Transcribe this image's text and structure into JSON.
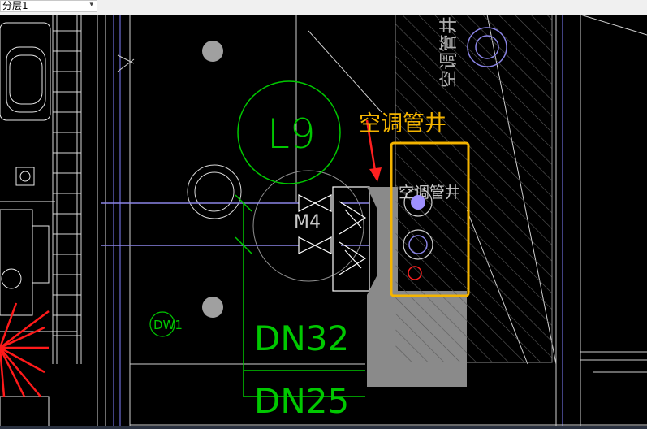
{
  "toolbar": {
    "layer_select": {
      "value": "分层1",
      "icon": "chevron-down-icon"
    }
  },
  "drawing": {
    "annotation": "空调管井",
    "labels": {
      "l9": "L9",
      "m4": "M4",
      "shaft": "空调管井",
      "dn32": "DN32",
      "dn25": "DN25",
      "dw1": "DW1"
    },
    "colors": {
      "background": "#000000",
      "annotation": "#f4b400",
      "pipe": "#00c800",
      "highlight_box": "#f4b400",
      "arrow": "#ff2020",
      "shaft_fill": "#808080",
      "blue_line": "#8a84e6"
    }
  }
}
